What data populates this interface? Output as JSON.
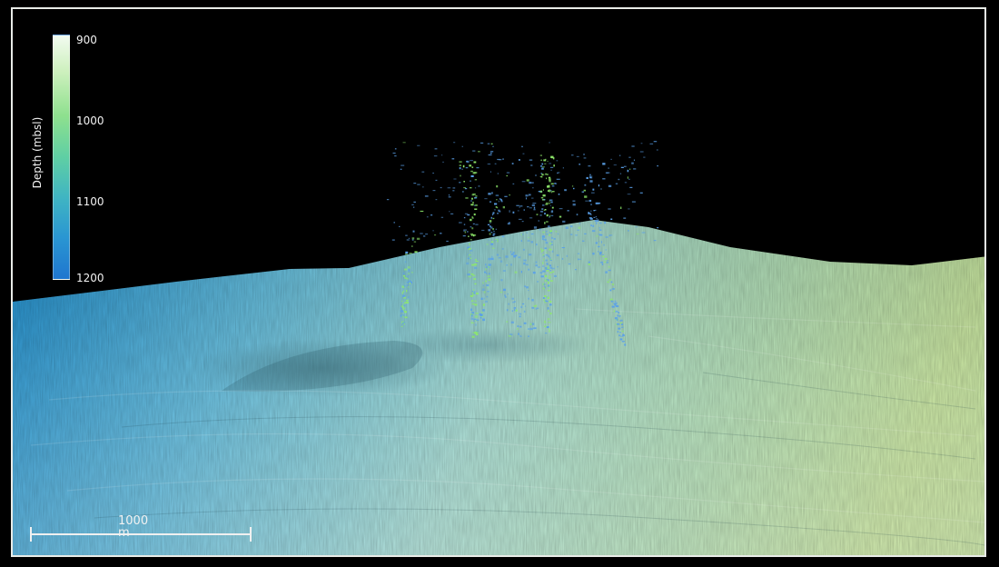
{
  "colorbar": {
    "title": "Depth (mbsl)",
    "ticks": [
      "900",
      "1000",
      "1100",
      "1200"
    ],
    "colors": [
      "#f2fbf0",
      "#8ee08e",
      "#3fb4c3",
      "#1f76cf"
    ]
  },
  "scale_bar": {
    "label": "1000 m"
  },
  "palette": {
    "background": "#000000",
    "frame": "#e9ece8",
    "seafloor_deep": "#1e8fd0",
    "seafloor_mid": "#8ed3d0",
    "seafloor_shallow": "#c8e6a2",
    "plume_blue": "#5aa0e8",
    "plume_green": "#8ee86a"
  }
}
